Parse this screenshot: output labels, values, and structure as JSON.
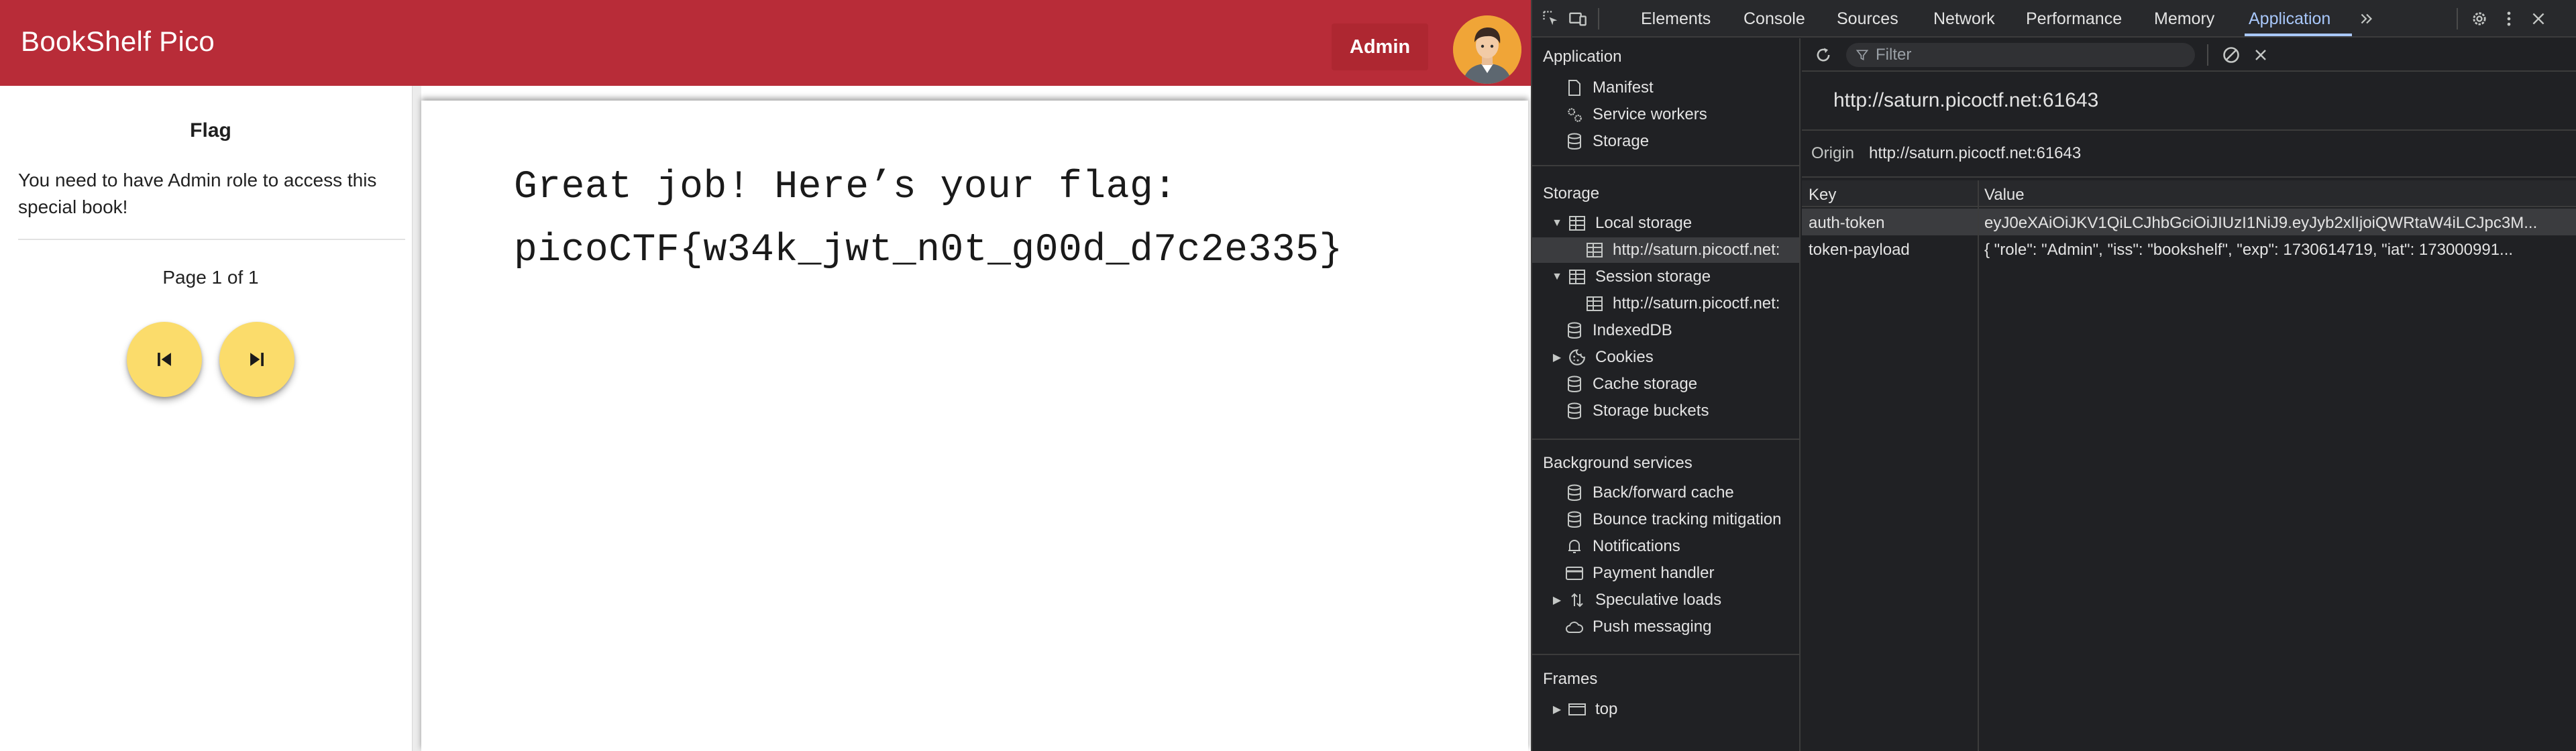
{
  "app": {
    "title": "BookShelf Pico",
    "admin_button": "Admin",
    "sidebar": {
      "heading": "Flag",
      "description": "You need to have Admin role to access this special book!",
      "page_info": "Page 1 of 1",
      "prev_icon": "skip-previous-icon",
      "next_icon": "skip-next-icon"
    },
    "book": {
      "line1": "Great job! Here’s your flag:",
      "line2": "picoCTF{w34k_jwt_n0t_g00d_d7c2e335}"
    },
    "colors": {
      "appbar": "#b82c38",
      "fab": "#fbdc6b",
      "avatar_bg": "#f0a537"
    }
  },
  "devtools": {
    "tabs": [
      "Elements",
      "Console",
      "Sources",
      "Network",
      "Performance",
      "Memory",
      "Application"
    ],
    "active_tab": "Application",
    "sidebar": {
      "application_section": "Application",
      "application_items": [
        "Manifest",
        "Service workers",
        "Storage"
      ],
      "storage_section": "Storage",
      "local_storage": "Local storage",
      "local_storage_child": "http://saturn.picoctf.net:",
      "session_storage": "Session storage",
      "session_storage_child": "http://saturn.picoctf.net:",
      "indexeddb": "IndexedDB",
      "cookies": "Cookies",
      "cache_storage": "Cache storage",
      "storage_buckets": "Storage buckets",
      "background_section": "Background services",
      "background_items": [
        "Back/forward cache",
        "Bounce tracking mitigation",
        "Notifications",
        "Payment handler",
        "Speculative loads",
        "Push messaging"
      ],
      "frames_section": "Frames",
      "frames_top": "top"
    },
    "main": {
      "filter_placeholder": "Filter",
      "origin_title": "http://saturn.picoctf.net:61643",
      "origin_label": "Origin",
      "origin_value": "http://saturn.picoctf.net:61643",
      "columns": [
        "Key",
        "Value"
      ],
      "rows": [
        {
          "key": "auth-token",
          "value": "eyJ0eXAiOiJKV1QiLCJhbGciOiJIUzI1NiJ9.eyJyb2xlIjoiQWRtaW4iLCJpc3M..."
        },
        {
          "key": "token-payload",
          "value": "{ \"role\": \"Admin\", \"iss\": \"bookshelf\", \"exp\": 1730614719, \"iat\": 173000991..."
        }
      ]
    },
    "colors": {
      "background": "#202124",
      "active_tab": "#a8c7fa"
    }
  }
}
